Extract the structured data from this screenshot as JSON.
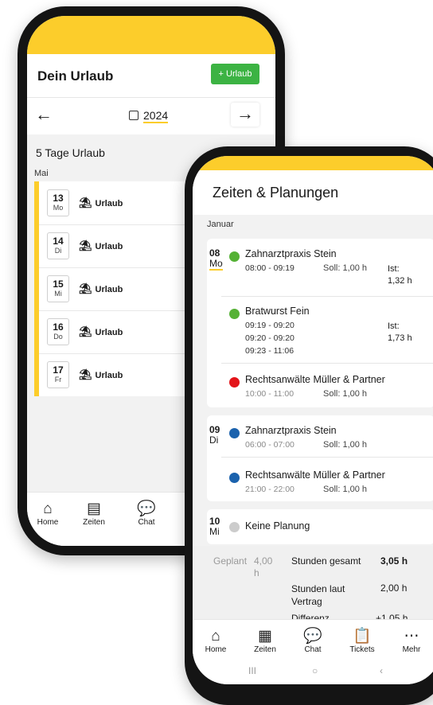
{
  "vacation_screen": {
    "title": "Dein Urlaub",
    "add_button_label": "+ Urlaub",
    "prev_arrow": "←",
    "next_arrow": "→",
    "year": "2024",
    "days_summary": "5 Tage Urlaub",
    "month": "Mai",
    "entries": [
      {
        "day": "13",
        "weekday": "Mo",
        "label": "Urlaub"
      },
      {
        "day": "14",
        "weekday": "Di",
        "label": "Urlaub"
      },
      {
        "day": "15",
        "weekday": "Mi",
        "label": "Urlaub"
      },
      {
        "day": "16",
        "weekday": "Do",
        "label": "Urlaub"
      },
      {
        "day": "17",
        "weekday": "Fr",
        "label": "Urlaub"
      }
    ],
    "nav": [
      {
        "label": "Home",
        "icon": "home-icon"
      },
      {
        "label": "Zeiten",
        "icon": "calendar-icon"
      },
      {
        "label": "Chat",
        "icon": "chat-icon"
      }
    ]
  },
  "times_screen": {
    "title": "Zeiten & Planungen",
    "month": "Januar",
    "day1": {
      "day": "08",
      "weekday": "Mo",
      "entry1": {
        "name": "Zahnarztpraxis Stein",
        "time": "08:00 - 09:19",
        "soll_label": "Soll:",
        "soll_value": "1,00 h",
        "ist": "Ist: 1,32 h",
        "color": "#55b135"
      },
      "entry2": {
        "name": "Bratwurst Fein",
        "times": [
          "09:19 - 09:20",
          "09:20 - 09:20",
          "09:23 - 11:06"
        ],
        "ist": "Ist: 1,73 h",
        "color": "#55b135"
      },
      "entry3": {
        "name": "Rechtsanwälte Müller & Partner",
        "time": "10:00 - 11:00",
        "soll_label": "Soll:",
        "soll_value": "1,00 h",
        "color": "#e3141a"
      }
    },
    "day2": {
      "day": "09",
      "weekday": "Di",
      "entry1": {
        "name": "Zahnarztpraxis Stein",
        "time": "06:00 - 07:00",
        "soll_label": "Soll:",
        "soll_value": "1,00 h",
        "color": "#1b62ad"
      },
      "entry2": {
        "name": "Rechtsanwälte Müller & Partner",
        "time": "21:00 - 22:00",
        "soll_label": "Soll:",
        "soll_value": "1,00 h",
        "color": "#1b62ad"
      }
    },
    "day3": {
      "day": "10",
      "weekday": "Mi",
      "label": "Keine Planung",
      "color": "#cccccc"
    },
    "summary": {
      "planned_label": "Geplant",
      "planned_value": "4,00 h",
      "total_label": "Stunden gesamt",
      "total_value": "3,05 h",
      "contract_label": "Stunden laut Vertrag",
      "contract_value": "2,00 h",
      "diff_label": "Differenz",
      "diff_value": "+1,05 h"
    },
    "nav": [
      {
        "label": "Home",
        "icon": "home-icon"
      },
      {
        "label": "Zeiten",
        "icon": "calendar-icon"
      },
      {
        "label": "Chat",
        "icon": "chat-icon"
      },
      {
        "label": "Tickets",
        "icon": "clipboard-icon"
      },
      {
        "label": "Mehr",
        "icon": "more-icon"
      }
    ],
    "system_nav": [
      "III",
      "○",
      "‹"
    ]
  },
  "colors": {
    "brand_yellow": "#fccd2b",
    "button_green": "#3cb343"
  }
}
